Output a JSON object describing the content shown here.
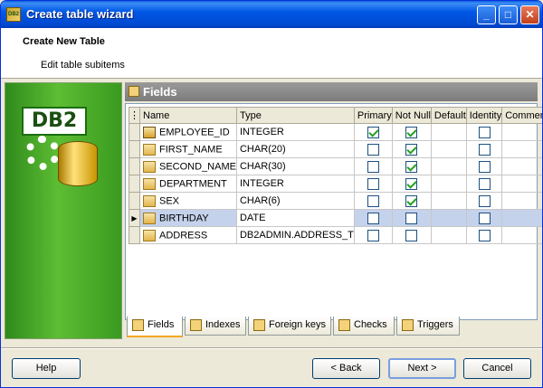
{
  "window": {
    "title": "Create table wizard"
  },
  "header": {
    "title": "Create New Table",
    "subtitle": "Edit table subitems"
  },
  "sidebar": {
    "logo_text": "DB2"
  },
  "panel": {
    "title": "Fields"
  },
  "grid": {
    "columns": [
      "Name",
      "Type",
      "Primary",
      "Not Null",
      "Default",
      "Identity",
      "Comment"
    ],
    "rows": [
      {
        "name": "EMPLOYEE_ID",
        "type": "INTEGER",
        "primary": true,
        "not_null": true,
        "identity": false,
        "key": true
      },
      {
        "name": "FIRST_NAME",
        "type": "CHAR(20)",
        "primary": false,
        "not_null": true,
        "identity": false
      },
      {
        "name": "SECOND_NAME",
        "type": "CHAR(30)",
        "primary": false,
        "not_null": true,
        "identity": false
      },
      {
        "name": "DEPARTMENT",
        "type": "INTEGER",
        "primary": false,
        "not_null": true,
        "identity": false
      },
      {
        "name": "SEX",
        "type": "CHAR(6)",
        "primary": false,
        "not_null": true,
        "identity": false
      },
      {
        "name": "BIRTHDAY",
        "type": "DATE",
        "primary": false,
        "not_null": false,
        "identity": false,
        "selected": true
      },
      {
        "name": "ADDRESS",
        "type": "DB2ADMIN.ADDRESS_T",
        "primary": false,
        "not_null": false,
        "identity": false
      }
    ]
  },
  "tabs": [
    {
      "label": "Fields",
      "active": true
    },
    {
      "label": "Indexes"
    },
    {
      "label": "Foreign keys"
    },
    {
      "label": "Checks"
    },
    {
      "label": "Triggers"
    }
  ],
  "buttons": {
    "help": "Help",
    "back": "< Back",
    "next": "Next >",
    "cancel": "Cancel"
  }
}
